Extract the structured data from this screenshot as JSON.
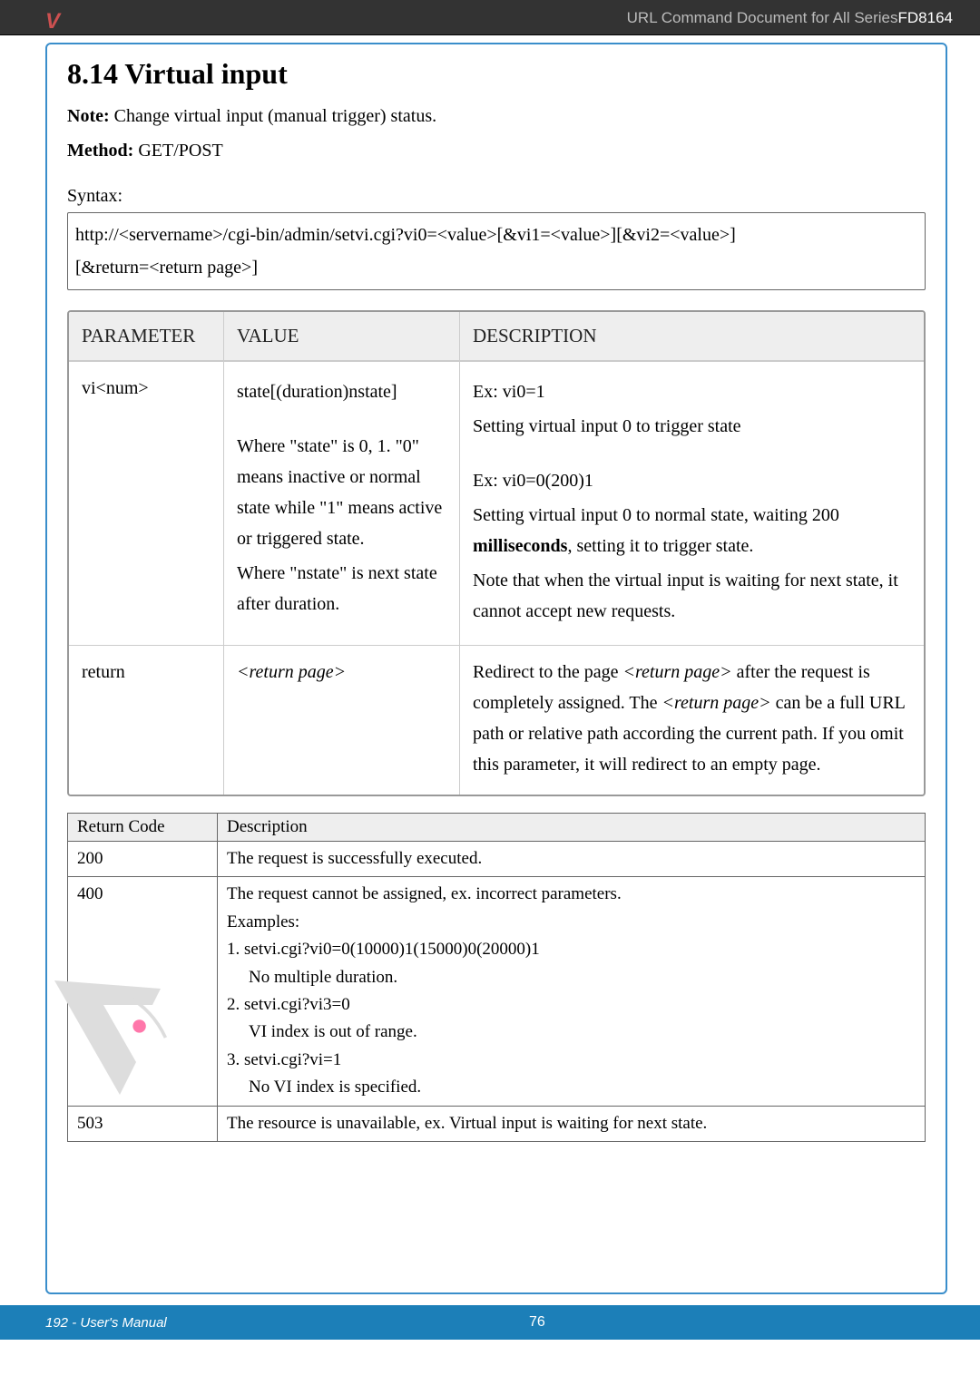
{
  "header": {
    "brand_letter": "V",
    "right_text_prefix": "URL Command Document for All Series",
    "right_text_model": "FD8164"
  },
  "section": {
    "title": "8.14 Virtual input",
    "note_label": "Note:",
    "note_text": " Change virtual input (manual trigger) status.",
    "method_label": "Method:",
    "method_text": " GET/POST",
    "syntax_label": "Syntax:",
    "syntax_line1": "http://<servername>/cgi-bin/admin/setvi.cgi?vi0=<value>[&vi1=<value>][&vi2=<value>]",
    "syntax_line2": "[&return=<return page>]"
  },
  "param_table": {
    "headers": {
      "c1": "PARAMETER",
      "c2": "VALUE",
      "c3": "DESCRIPTION"
    },
    "row1": {
      "param": "vi<num>",
      "value_main": "state[(duration)nstate]",
      "value_where1": "Where \"state\" is 0, 1. \"0\" means inactive or normal state while \"1\" means active or triggered state.",
      "value_where2": "Where \"nstate\" is next state after duration.",
      "desc_ex1": "Ex: vi0=1",
      "desc_set1": "Setting virtual input 0 to trigger state",
      "desc_ex2": "Ex: vi0=0(200)1",
      "desc_set2a": "Setting virtual input 0 to normal state, waiting 200 ",
      "desc_set2b_bold": "milliseconds",
      "desc_set2c": ", setting it to trigger state.",
      "desc_note": "Note that when the virtual input is waiting for next state, it cannot accept new requests."
    },
    "row2": {
      "param": "return",
      "value": "<return page>",
      "desc_a": "Redirect to the page ",
      "desc_b_it": "<return page>",
      "desc_c": " after the request is completely assigned. The ",
      "desc_d_it": "<return page>",
      "desc_e": " can be a full URL path or relative path according the current path. If you omit this parameter, it will redirect to an empty page."
    }
  },
  "rc_table": {
    "headers": {
      "c1": "Return Code",
      "c2": "Description"
    },
    "r200": {
      "code": "200",
      "desc": "The request is successfully executed."
    },
    "r400": {
      "code": "400",
      "line1": "The request cannot be assigned, ex. incorrect parameters.",
      "line2": "Examples:",
      "line3": "1. setvi.cgi?vi0=0(10000)1(15000)0(20000)1",
      "line3b": "No multiple duration.",
      "line4": "2. setvi.cgi?vi3=0",
      "line4b": "VI index is out of range.",
      "line5": "3. setvi.cgi?vi=1",
      "line5b": "No VI index is specified."
    },
    "r503": {
      "code": "503",
      "desc": "The resource is unavailable, ex. Virtual input is waiting for next state."
    }
  },
  "footer": {
    "left": "192 - User's Manual",
    "page": "76"
  }
}
